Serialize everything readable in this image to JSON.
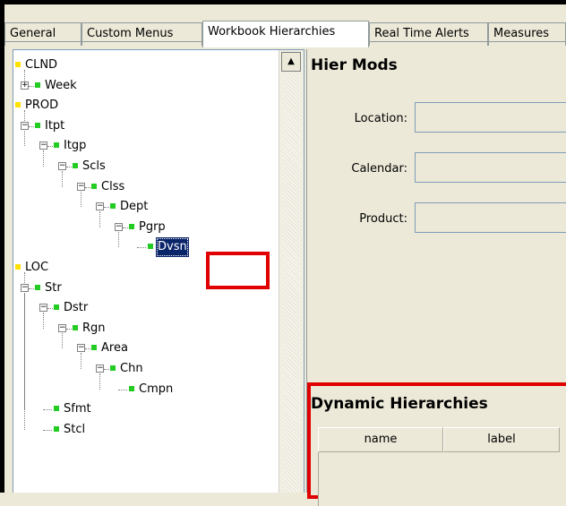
{
  "tabs": [
    {
      "label": "General",
      "active": false
    },
    {
      "label": "Custom Menus",
      "active": false
    },
    {
      "label": "Workbook Hierarchies",
      "active": true
    },
    {
      "label": "Real Time Alerts",
      "active": false
    },
    {
      "label": "Measures",
      "active": false
    }
  ],
  "tree": {
    "nodes": [
      {
        "label": "CLND",
        "level": 0,
        "type": "root"
      },
      {
        "label": "Week",
        "level": 1,
        "toggle": "+"
      },
      {
        "label": "PROD",
        "level": 0,
        "type": "root"
      },
      {
        "label": "Itpt",
        "level": 1,
        "toggle": "-"
      },
      {
        "label": "Itgp",
        "level": 2,
        "toggle": "-"
      },
      {
        "label": "Scls",
        "level": 3,
        "toggle": "-"
      },
      {
        "label": "Clss",
        "level": 4,
        "toggle": "-"
      },
      {
        "label": "Dept",
        "level": 5,
        "toggle": "-"
      },
      {
        "label": "Pgrp",
        "level": 6,
        "toggle": "-"
      },
      {
        "label": "Dvsn",
        "level": 7,
        "toggle": "",
        "selected": true
      },
      {
        "label": "LOC",
        "level": 0,
        "type": "root"
      },
      {
        "label": "Str",
        "level": 1,
        "toggle": "-"
      },
      {
        "label": "Dstr",
        "level": 2,
        "toggle": "-"
      },
      {
        "label": "Rgn",
        "level": 3,
        "toggle": "-"
      },
      {
        "label": "Area",
        "level": 4,
        "toggle": "-"
      },
      {
        "label": "Chn",
        "level": 5,
        "toggle": "-"
      },
      {
        "label": "Cmpn",
        "level": 6,
        "toggle": ""
      },
      {
        "label": "Sfmt",
        "level": 2,
        "toggle": ""
      },
      {
        "label": "Stcl",
        "level": 2,
        "toggle": ""
      }
    ]
  },
  "hier_mods": {
    "title": "Hier Mods",
    "fields": [
      {
        "label": "Location:",
        "value": ""
      },
      {
        "label": "Calendar:",
        "value": ""
      },
      {
        "label": "Product:",
        "value": ""
      }
    ]
  },
  "dynamic_hierarchies": {
    "title": "Dynamic Hierarchies",
    "columns": [
      "name",
      "label"
    ]
  },
  "colors": {
    "highlight_border": "#e00000",
    "selection_bg": "#0a246a",
    "node_root": "#ffe100",
    "node_child": "#22cc22"
  },
  "icons": {
    "scroll_up": "scroll-up-arrow-icon",
    "expand": "tree-expand-icon",
    "collapse": "tree-collapse-icon"
  }
}
